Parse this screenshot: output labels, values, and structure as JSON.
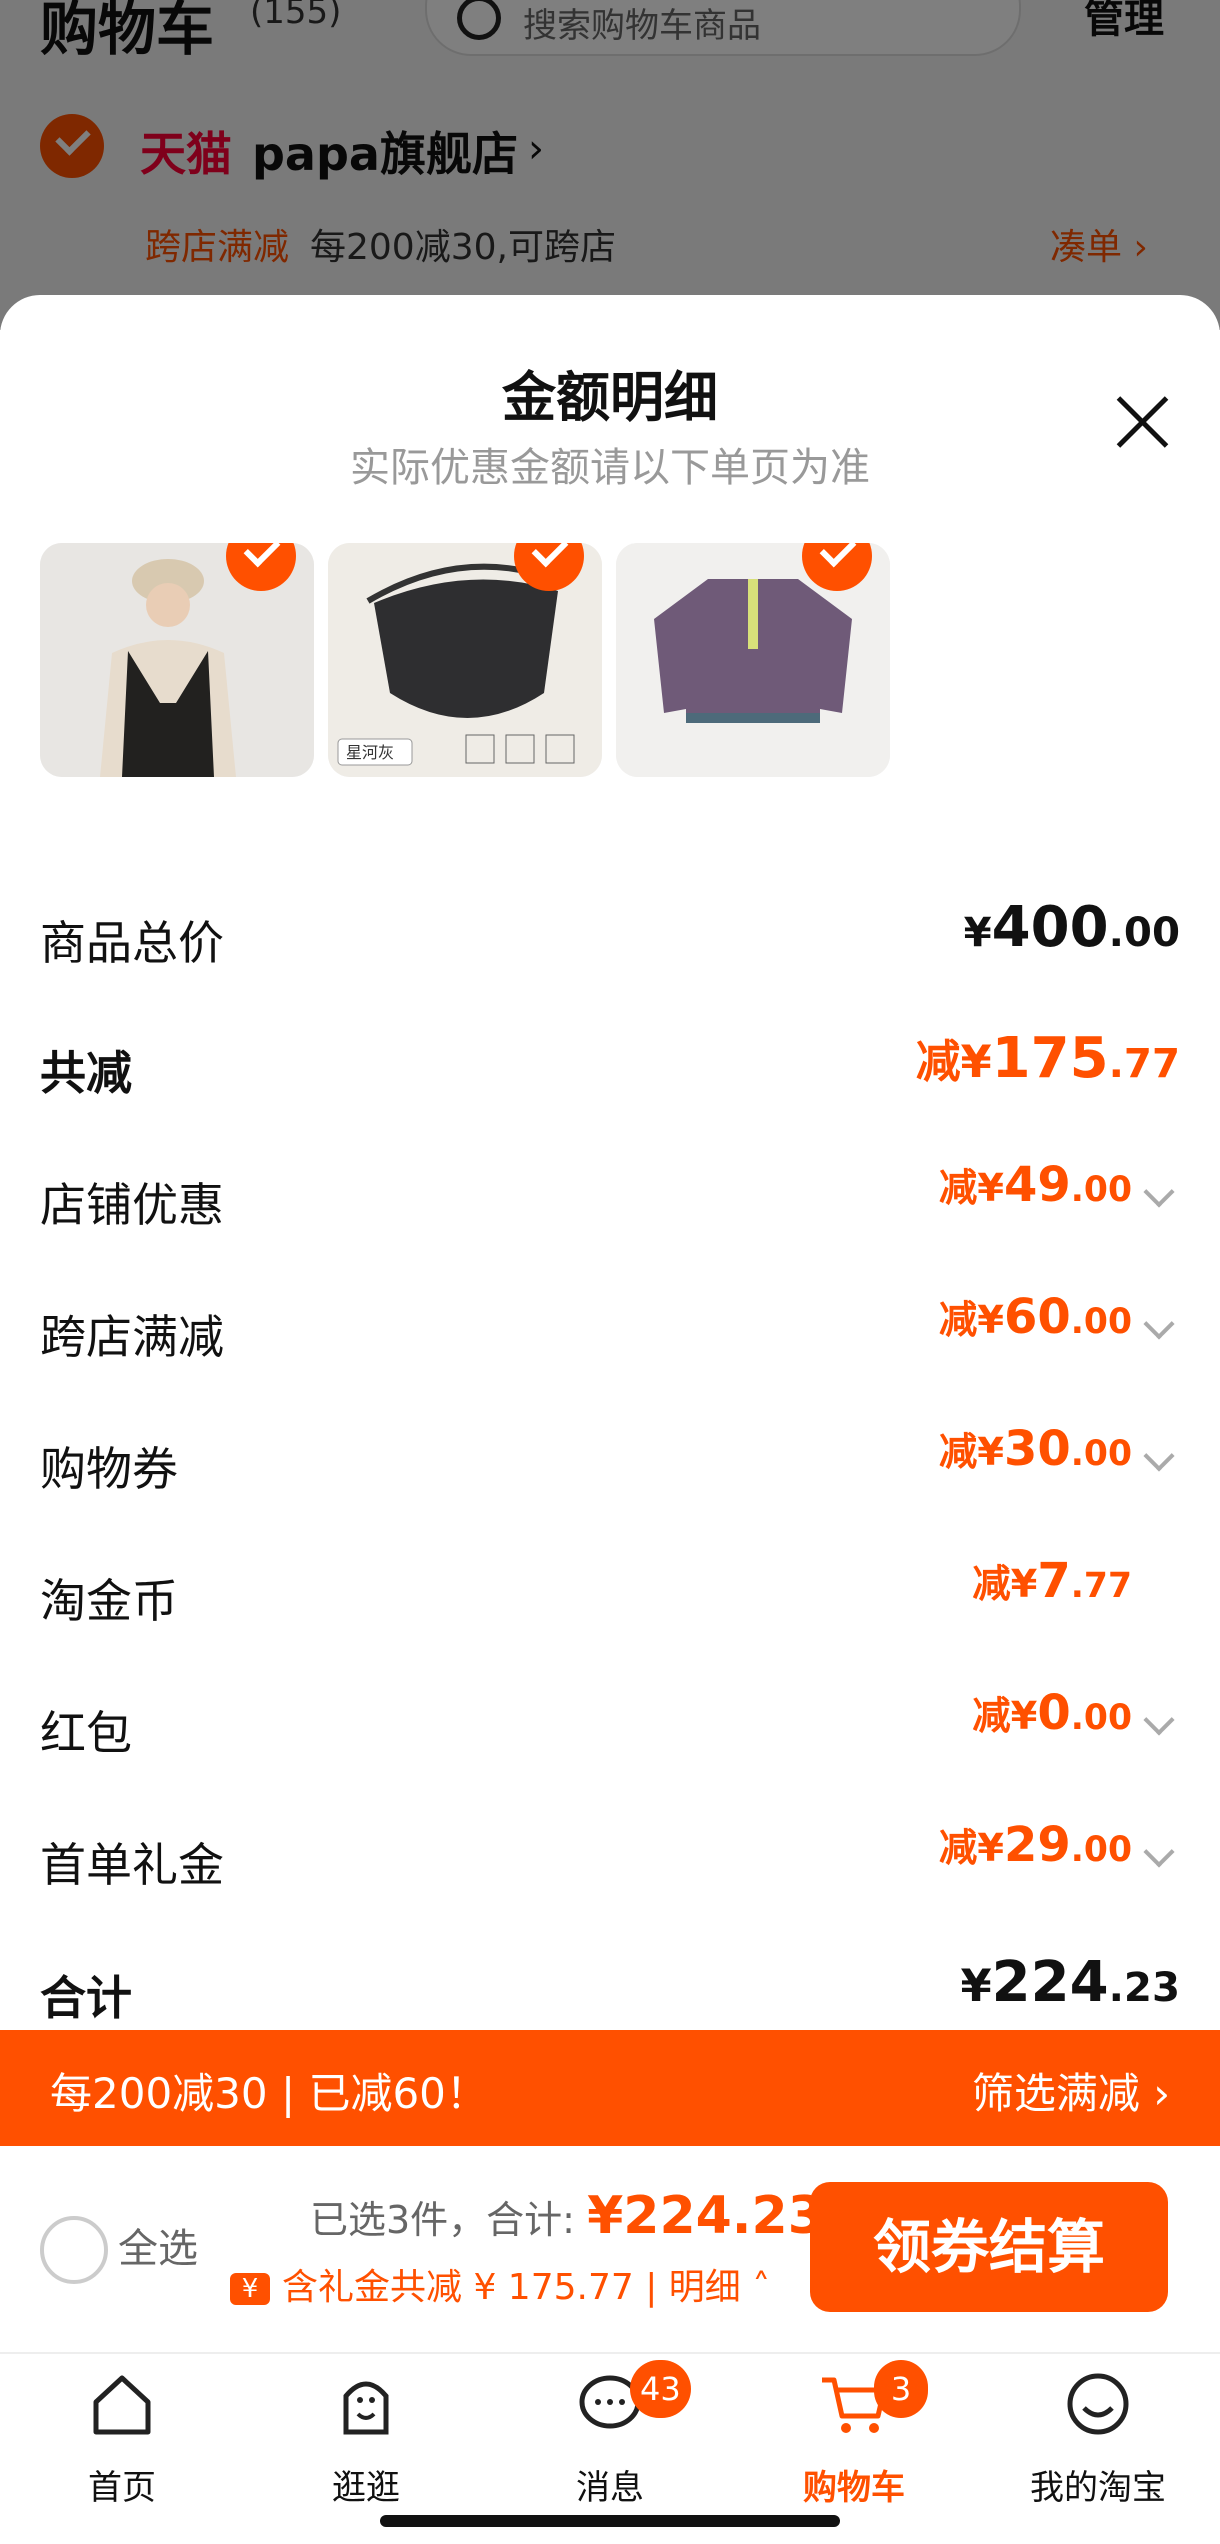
{
  "background_cart": {
    "title": "购物车",
    "count": "(155)",
    "search_placeholder": "搜索购物车商品",
    "manage": "管理",
    "store_platform": "天猫",
    "store_name": "papa旗舰店",
    "promo_tag": "跨店满减",
    "promo_text": "每200减30,可跨店",
    "collect": "凑单"
  },
  "sheet": {
    "title": "金额明细",
    "subtitle": "实际优惠金额请以下单页为准",
    "products": [
      {
        "name": "black-vest-product-image"
      },
      {
        "name": "black-mask-product-image",
        "tag": "星河灰"
      },
      {
        "name": "purple-sweatshirt-product-image"
      }
    ],
    "rows": [
      {
        "label": "商品总价",
        "prefix": "¥",
        "int": "400",
        "dec": ".00",
        "accent": false,
        "bold": true
      },
      {
        "label": "共减",
        "prefix": "减¥",
        "int": "175",
        "dec": ".77",
        "accent": true,
        "bold": true
      },
      {
        "label": "店铺优惠",
        "prefix": "减¥",
        "int": "49",
        "dec": ".00",
        "accent": true,
        "expand": true
      },
      {
        "label": "跨店满减",
        "prefix": "减¥",
        "int": "60",
        "dec": ".00",
        "accent": true,
        "expand": true
      },
      {
        "label": "购物券",
        "prefix": "减¥",
        "int": "30",
        "dec": ".00",
        "accent": true,
        "expand": true
      },
      {
        "label": "淘金币",
        "prefix": "减¥",
        "int": "7",
        "dec": ".77",
        "accent": true,
        "expand": false
      },
      {
        "label": "红包",
        "prefix": "减¥",
        "int": "0",
        "dec": ".00",
        "accent": true,
        "expand": true
      },
      {
        "label": "首单礼金",
        "prefix": "减¥",
        "int": "29",
        "dec": ".00",
        "accent": true,
        "expand": true
      },
      {
        "label": "合计",
        "prefix": "¥",
        "int": "224",
        "dec": ".23",
        "accent": false,
        "bold": true
      }
    ]
  },
  "banner": {
    "left": "每200减30 | 已减60！",
    "right": "筛选满减"
  },
  "checkout_bar": {
    "select_all": "全选",
    "selected_text": "已选3件，合计:",
    "total": "¥224.23",
    "detail_text": "含礼金共减 ¥ 175.77 | 明细",
    "ticket_icon": "¥",
    "checkout_button": "领券结算"
  },
  "tabbar": {
    "tabs": [
      {
        "label": "首页",
        "icon": "home-icon"
      },
      {
        "label": "逛逛",
        "icon": "browse-icon"
      },
      {
        "label": "消息",
        "icon": "message-icon",
        "badge": "43"
      },
      {
        "label": "购物车",
        "icon": "cart-icon",
        "badge": "3",
        "active": true
      },
      {
        "label": "我的淘宝",
        "icon": "profile-icon"
      }
    ]
  },
  "colors": {
    "accent": "#ff5000",
    "tmall": "#ff0036"
  }
}
